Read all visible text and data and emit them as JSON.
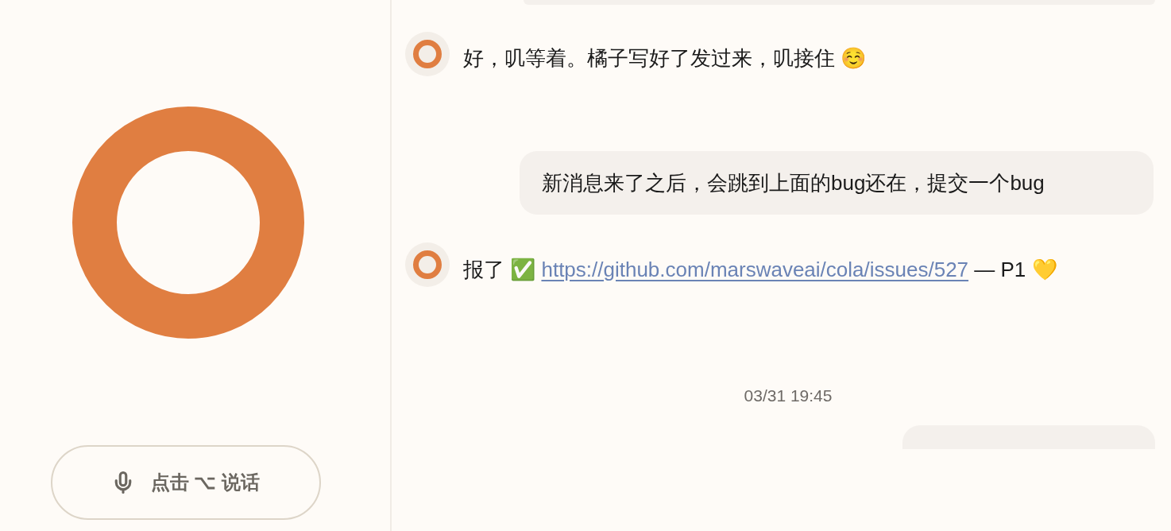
{
  "voice_button": {
    "label": "点击 ⌥ 说话"
  },
  "messages": [
    {
      "kind": "user_cut"
    },
    {
      "kind": "assistant",
      "text": "好，叽等着。橘子写好了发过来，叽接住 ☺️"
    },
    {
      "kind": "user",
      "text": "新消息来了之后，会跳到上面的bug还在，提交一个bug"
    },
    {
      "kind": "assistant_link",
      "text_before": "报了 ✅ ",
      "link": "https://github.com/marswaveai/cola/issues/527",
      "text_after": " — P1 💛"
    },
    {
      "kind": "timestamp",
      "text": "03/31 19:45"
    },
    {
      "kind": "user_cut"
    }
  ]
}
